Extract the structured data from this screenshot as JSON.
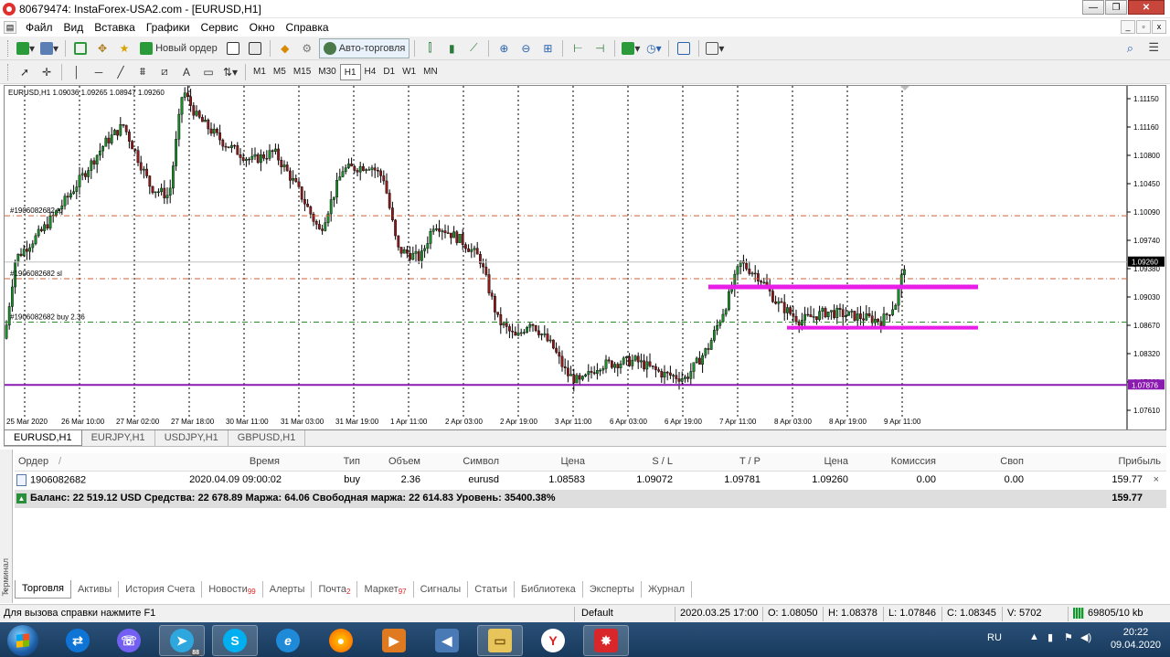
{
  "window": {
    "title": "80679474: InstaForex-USA2.com - [EURUSD,H1]",
    "minimize": "—",
    "restore": "❐",
    "close": "✕"
  },
  "menu": {
    "items": [
      "Файл",
      "Вид",
      "Вставка",
      "Графики",
      "Сервис",
      "Окно",
      "Справка"
    ],
    "mdi_min": "_",
    "mdi_restore": "▫",
    "mdi_close": "x"
  },
  "toolbar": {
    "new_order": "Новый ордер",
    "auto_trading": "Авто-торговля"
  },
  "timeframes": [
    "M1",
    "M5",
    "M15",
    "M30",
    "H1",
    "H4",
    "D1",
    "W1",
    "MN"
  ],
  "active_timeframe": "H1",
  "chart": {
    "symbol_info": "EURUSD,H1  1.09036 1.09265 1.08947 1.09260",
    "price_labels": [
      "1.11150",
      "1.11160",
      "1.10800",
      "1.10450",
      "1.10090",
      "1.09740",
      "1.09380",
      "1.09030",
      "1.08670",
      "1.08320",
      "1.07960",
      "1.07610"
    ],
    "current_price": "1.09260",
    "support_price": "1.07876",
    "date_labels": [
      "25 Mar 2020",
      "26 Mar 10:00",
      "27 Mar 02:00",
      "27 Mar 18:00",
      "30 Mar 11:00",
      "31 Mar 03:00",
      "31 Mar 19:00",
      "1 Apr 11:00",
      "2 Apr 03:00",
      "2 Apr 19:00",
      "3 Apr 11:00",
      "6 Apr 03:00",
      "6 Apr 19:00",
      "7 Apr 11:00",
      "8 Apr 03:00",
      "8 Apr 19:00",
      "9 Apr 11:00"
    ],
    "order_tp_label": "#1906082682 tp",
    "order_sl_label": "#1906082682 sl",
    "order_buy_label": "#1906082682 buy 2.36",
    "colors": {
      "bull": "#1a8a2a",
      "bear": "#8b1a1a",
      "tp": "#d0603a",
      "buy": "#2a8a2a",
      "support": "#8a1ab0",
      "zone": "#e81ee8",
      "grid": "#000000"
    }
  },
  "chart_tabs": [
    "EURUSD,H1",
    "EURJPY,H1",
    "USDJPY,H1",
    "GBPUSD,H1"
  ],
  "terminal": {
    "side_label": "Терминал",
    "close": "×",
    "headers": [
      "Ордер",
      "/",
      "Время",
      "Тип",
      "Объем",
      "Символ",
      "Цена",
      "S / L",
      "T / P",
      "Цена",
      "Комиссия",
      "Своп",
      "Прибыль"
    ],
    "order": {
      "id": "1906082682",
      "time": "2020.04.09 09:00:02",
      "type": "buy",
      "volume": "2.36",
      "symbol": "eurusd",
      "open_price": "1.08583",
      "sl": "1.09072",
      "tp": "1.09781",
      "price": "1.09260",
      "commission": "0.00",
      "swap": "0.00",
      "profit": "159.77",
      "close": "×"
    },
    "balance": {
      "text": "Баланс: 22 519.12 USD  Средства: 22 678.89  Маржа: 64.06  Свободная маржа: 22 614.83  Уровень: 35400.38%",
      "profit": "159.77"
    },
    "tabs": [
      {
        "label": "Торговля",
        "badge": ""
      },
      {
        "label": "Активы",
        "badge": ""
      },
      {
        "label": "История Счета",
        "badge": ""
      },
      {
        "label": "Новости",
        "badge": "99"
      },
      {
        "label": "Алерты",
        "badge": ""
      },
      {
        "label": "Почта",
        "badge": "2"
      },
      {
        "label": "Маркет",
        "badge": "97"
      },
      {
        "label": "Сигналы",
        "badge": ""
      },
      {
        "label": "Статьи",
        "badge": ""
      },
      {
        "label": "Библиотека",
        "badge": ""
      },
      {
        "label": "Эксперты",
        "badge": ""
      },
      {
        "label": "Журнал",
        "badge": ""
      }
    ]
  },
  "status": {
    "help": "Для вызова справки нажмите F1",
    "profile": "Default",
    "datetime": "2020.03.25 17:00",
    "open": "O: 1.08050",
    "high": "H: 1.08378",
    "low": "L: 1.07846",
    "close": "C: 1.08345",
    "volume": "V: 5702",
    "traffic": "69805/10 kb"
  },
  "taskbar": {
    "lang": "RU",
    "time": "20:22",
    "date": "09.04.2020",
    "telegram_badge": "88"
  }
}
